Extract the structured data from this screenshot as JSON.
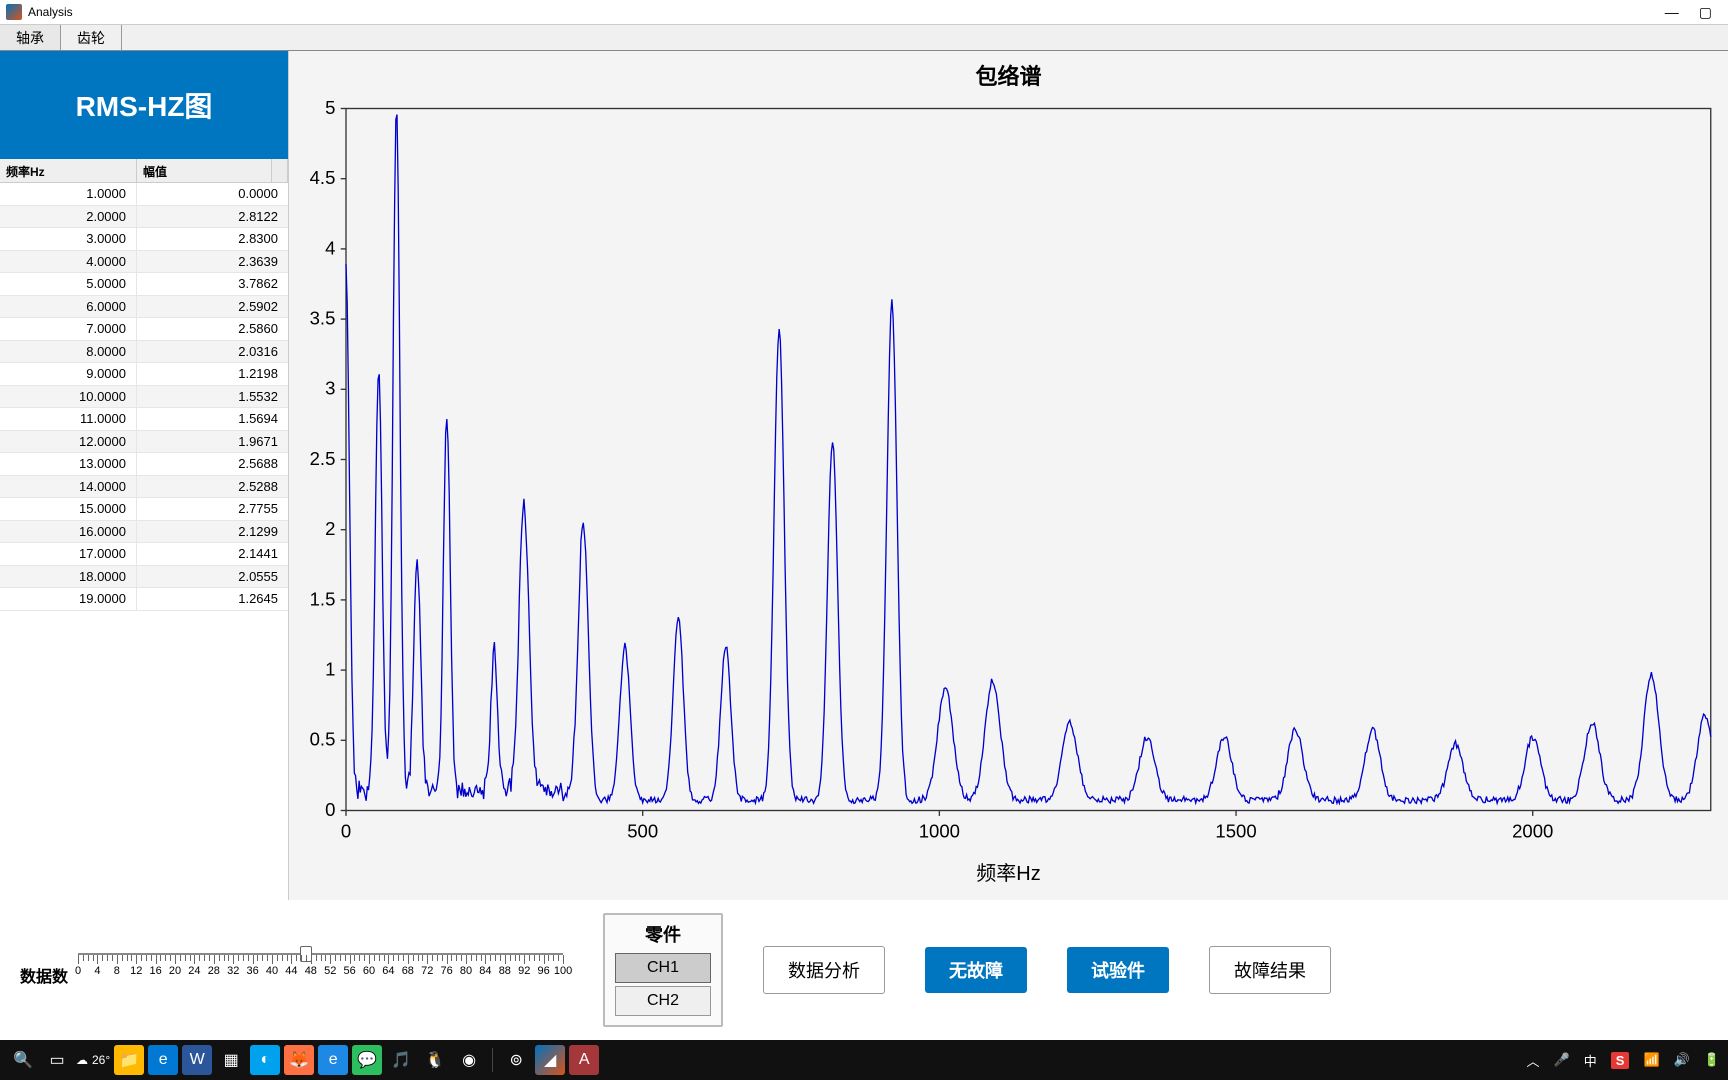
{
  "titlebar": {
    "title": "Analysis"
  },
  "tabs": [
    "轴承",
    "齿轮"
  ],
  "activeTab": 0,
  "leftPanel": {
    "header": "RMS-HZ图",
    "cols": [
      "频率Hz",
      "幅值"
    ],
    "rows": [
      [
        "1.0000",
        "0.0000"
      ],
      [
        "2.0000",
        "2.8122"
      ],
      [
        "3.0000",
        "2.8300"
      ],
      [
        "4.0000",
        "2.3639"
      ],
      [
        "5.0000",
        "3.7862"
      ],
      [
        "6.0000",
        "2.5902"
      ],
      [
        "7.0000",
        "2.5860"
      ],
      [
        "8.0000",
        "2.0316"
      ],
      [
        "9.0000",
        "1.2198"
      ],
      [
        "10.0000",
        "1.5532"
      ],
      [
        "11.0000",
        "1.5694"
      ],
      [
        "12.0000",
        "1.9671"
      ],
      [
        "13.0000",
        "2.5688"
      ],
      [
        "14.0000",
        "2.5288"
      ],
      [
        "15.0000",
        "2.7755"
      ],
      [
        "16.0000",
        "2.1299"
      ],
      [
        "17.0000",
        "2.1441"
      ],
      [
        "18.0000",
        "2.0555"
      ],
      [
        "19.0000",
        "1.2645"
      ]
    ]
  },
  "chart_data": {
    "type": "line",
    "title": "包络谱",
    "xlabel": "频率Hz",
    "ylabel": "",
    "xlim": [
      0,
      2300
    ],
    "ylim": [
      0,
      5
    ],
    "xticks": [
      0,
      500,
      1000,
      1500,
      2000
    ],
    "yticks": [
      0,
      0.5,
      1,
      1.5,
      2,
      2.5,
      3,
      3.5,
      4,
      4.5,
      5
    ],
    "peaks": [
      {
        "x": 0,
        "y": 3.7
      },
      {
        "x": 55,
        "y": 3.0
      },
      {
        "x": 85,
        "y": 4.9
      },
      {
        "x": 120,
        "y": 1.7
      },
      {
        "x": 170,
        "y": 2.7
      },
      {
        "x": 250,
        "y": 1.0
      },
      {
        "x": 300,
        "y": 2.05
      },
      {
        "x": 400,
        "y": 1.95
      },
      {
        "x": 470,
        "y": 1.1
      },
      {
        "x": 560,
        "y": 1.3
      },
      {
        "x": 640,
        "y": 1.1
      },
      {
        "x": 730,
        "y": 3.35
      },
      {
        "x": 820,
        "y": 2.55
      },
      {
        "x": 920,
        "y": 3.55
      },
      {
        "x": 1010,
        "y": 0.8
      },
      {
        "x": 1090,
        "y": 0.85
      },
      {
        "x": 1220,
        "y": 0.55
      },
      {
        "x": 1350,
        "y": 0.45
      },
      {
        "x": 1480,
        "y": 0.45
      },
      {
        "x": 1600,
        "y": 0.5
      },
      {
        "x": 1730,
        "y": 0.5
      },
      {
        "x": 1870,
        "y": 0.4
      },
      {
        "x": 2000,
        "y": 0.45
      },
      {
        "x": 2100,
        "y": 0.55
      },
      {
        "x": 2200,
        "y": 0.9
      },
      {
        "x": 2290,
        "y": 0.6
      }
    ]
  },
  "slider": {
    "label": "数据数",
    "min": 0,
    "max": 100,
    "value": 47,
    "majorTicks": [
      0,
      4,
      8,
      12,
      16,
      20,
      24,
      28,
      32,
      36,
      40,
      44,
      48,
      52,
      56,
      60,
      64,
      68,
      72,
      76,
      80,
      84,
      88,
      92,
      96,
      100
    ]
  },
  "partBox": {
    "title": "零件",
    "options": [
      "CH1",
      "CH2"
    ],
    "active": 0
  },
  "buttons": {
    "analyze": "数据分析",
    "noFault": "无故障",
    "testPiece": "试验件",
    "faultResult": "故障结果"
  },
  "taskbar": {
    "weather": "26°",
    "lang": "中",
    "time": ""
  }
}
